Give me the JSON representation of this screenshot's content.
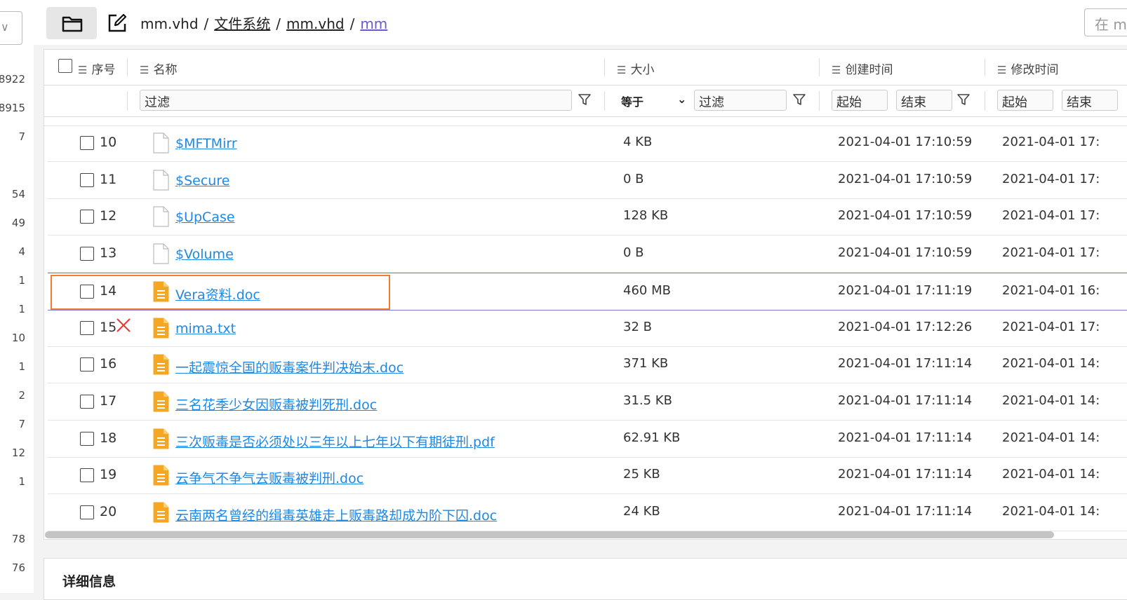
{
  "left_panel": {
    "numbers": [
      "8922",
      "8915",
      "7",
      "54",
      "49",
      "4",
      "1",
      "1",
      "10",
      "1",
      "2",
      "7",
      "12",
      "1",
      "78",
      "76"
    ]
  },
  "toolbar": {
    "breadcrumb": [
      "mm.vhd",
      "文件系统",
      "mm.vhd",
      "mm"
    ],
    "search_placeholder": "在 m"
  },
  "table": {
    "columns": {
      "index": "序号",
      "name": "名称",
      "size": "大小",
      "created": "创建时间",
      "modified": "修改时间"
    },
    "filters": {
      "name_placeholder": "过滤",
      "size_operator": "等于",
      "size_placeholder": "过滤",
      "created_start": "起始",
      "created_end": "结束",
      "modified_start": "起始",
      "modified_end": "结束"
    },
    "rows": [
      {
        "index": "10",
        "name": "$MFTMirr",
        "size": "4 KB",
        "created": "2021-04-01 17:10:59",
        "modified": "2021-04-01 17:",
        "icon": "blank-file"
      },
      {
        "index": "11",
        "name": "$Secure",
        "size": "0 B",
        "created": "2021-04-01 17:10:59",
        "modified": "2021-04-01 17:",
        "icon": "blank-file"
      },
      {
        "index": "12",
        "name": "$UpCase",
        "size": "128 KB",
        "created": "2021-04-01 17:10:59",
        "modified": "2021-04-01 17:",
        "icon": "blank-file"
      },
      {
        "index": "13",
        "name": "$Volume",
        "size": "0 B",
        "created": "2021-04-01 17:10:59",
        "modified": "2021-04-01 17:",
        "icon": "blank-file"
      },
      {
        "index": "14",
        "name": "Vera资料.doc",
        "size": "460 MB",
        "created": "2021-04-01 17:11:19",
        "modified": "2021-04-01 16:",
        "icon": "doc-file"
      },
      {
        "index": "15",
        "name": "mima.txt",
        "size": "32 B",
        "created": "2021-04-01 17:12:26",
        "modified": "2021-04-01 17:",
        "icon": "doc-file"
      },
      {
        "index": "16",
        "name": "一起震惊全国的贩毒案件判决始末.doc",
        "size": "371 KB",
        "created": "2021-04-01 17:11:14",
        "modified": "2021-04-01 14:",
        "icon": "doc-file"
      },
      {
        "index": "17",
        "name": "三名花季少女因贩毒被判死刑.doc",
        "size": "31.5 KB",
        "created": "2021-04-01 17:11:14",
        "modified": "2021-04-01 14:",
        "icon": "doc-file"
      },
      {
        "index": "18",
        "name": "三次贩毒是否必须处以三年以上七年以下有期徒刑.pdf",
        "size": "62.91 KB",
        "created": "2021-04-01 17:11:14",
        "modified": "2021-04-01 14:",
        "icon": "doc-file"
      },
      {
        "index": "19",
        "name": "云争气不争气去贩毒被判刑.doc",
        "size": "25 KB",
        "created": "2021-04-01 17:11:14",
        "modified": "2021-04-01 14:",
        "icon": "doc-file"
      },
      {
        "index": "20",
        "name": "云南两名曾经的缉毒英雄走上贩毒路却成为阶下囚.doc",
        "size": "24 KB",
        "created": "2021-04-01 17:11:14",
        "modified": "2021-04-01 14:",
        "icon": "doc-file"
      }
    ]
  },
  "detail_panel": {
    "title": "详细信息"
  },
  "colors": {
    "link": "#1e88e5",
    "highlight": "#ef7d2c",
    "doc_icon": "#f5a623",
    "selected_border": "#7b7bd6",
    "red_x": "#e53935"
  }
}
